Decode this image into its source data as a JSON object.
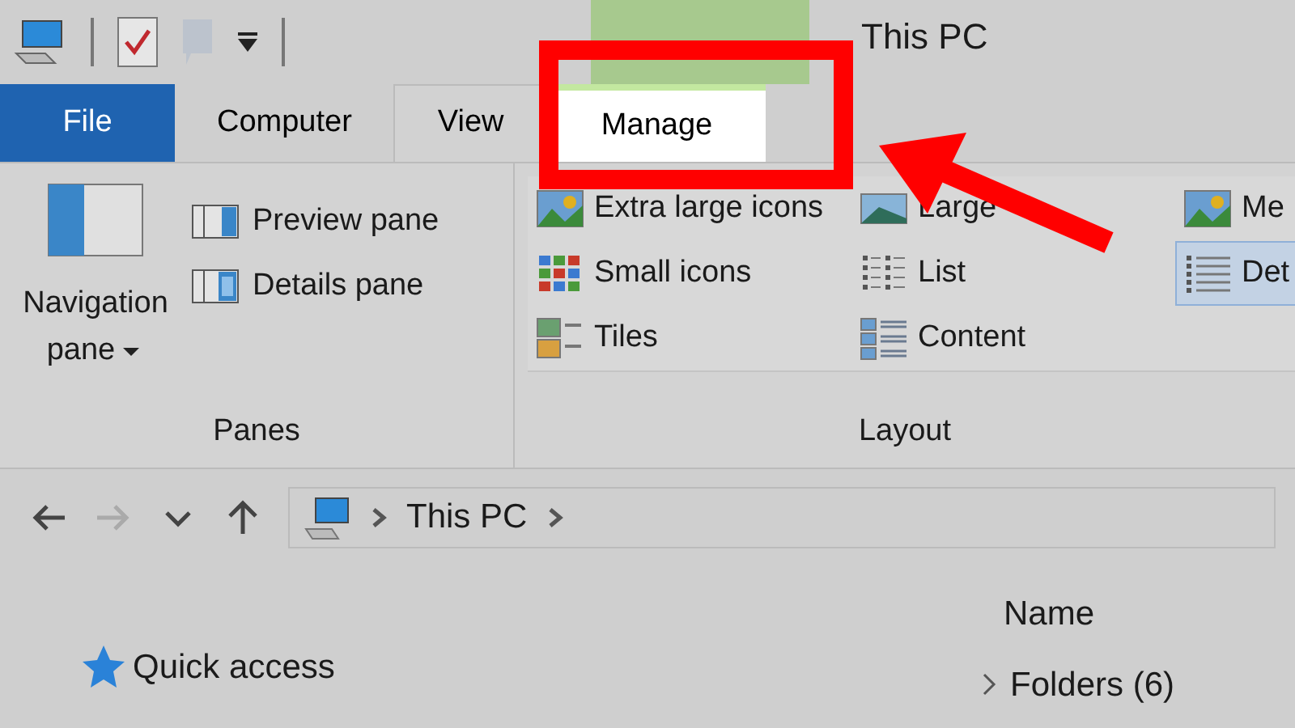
{
  "title_bar": {
    "title": "This PC"
  },
  "tabs": [
    {
      "label": "File",
      "kind": "file",
      "selected": false
    },
    {
      "label": "Computer",
      "kind": "tab",
      "selected": false
    },
    {
      "label": "View",
      "kind": "tab",
      "selected": false
    },
    {
      "label": "Manage",
      "kind": "context",
      "selected": true
    }
  ],
  "ribbon": {
    "panes": {
      "big_button": {
        "line1": "Navigation",
        "line2": "pane"
      },
      "items": [
        {
          "label": "Preview pane",
          "kind": "preview"
        },
        {
          "label": "Details pane",
          "kind": "details"
        }
      ],
      "group_label": "Panes"
    },
    "layout": {
      "items": [
        {
          "label": "Extra large icons",
          "kind": "photo",
          "selected": false
        },
        {
          "label": "Large",
          "kind": "landscape",
          "selected": false
        },
        {
          "label": "Me",
          "kind": "photo",
          "selected": false
        },
        {
          "label": "Small icons",
          "kind": "grid",
          "selected": false
        },
        {
          "label": "List",
          "kind": "list",
          "selected": false
        },
        {
          "label": "Det",
          "kind": "details",
          "selected": true
        },
        {
          "label": "Tiles",
          "kind": "tiles",
          "selected": false
        },
        {
          "label": "Content",
          "kind": "content",
          "selected": false
        }
      ],
      "group_label": "Layout"
    }
  },
  "address_bar": {
    "nav": [
      {
        "kind": "back",
        "disabled": false
      },
      {
        "kind": "forward",
        "disabled": true
      },
      {
        "kind": "recent",
        "disabled": false
      },
      {
        "kind": "up",
        "disabled": false
      }
    ],
    "path": "This PC"
  },
  "navigation_pane": {
    "items": [
      "Quick access"
    ]
  },
  "content": {
    "column_header": "Name",
    "groups": [
      "Folders (6)"
    ]
  },
  "annotation": {
    "highlight": true,
    "arrow": true
  }
}
